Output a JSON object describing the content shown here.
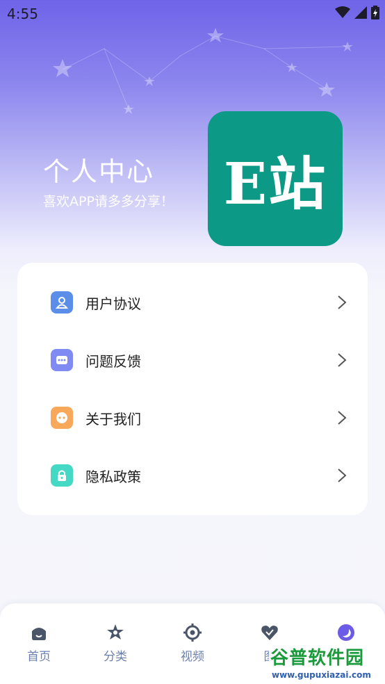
{
  "status_bar": {
    "time": "4:55"
  },
  "hero": {
    "title": "个人中心",
    "subtitle": "喜欢APP请多多分享！"
  },
  "logo": {
    "text": "E站",
    "color": "#0c9a86"
  },
  "menu": {
    "items": [
      {
        "label": "用户协议",
        "icon": "user-agreement-icon",
        "color": "#5b8ee8"
      },
      {
        "label": "问题反馈",
        "icon": "feedback-chat-icon",
        "color": "#7f8bf2"
      },
      {
        "label": "关于我们",
        "icon": "about-us-icon",
        "color": "#f7a85a"
      },
      {
        "label": "隐私政策",
        "icon": "privacy-lock-icon",
        "color": "#45d8c4"
      }
    ]
  },
  "bottom_nav": {
    "items": [
      {
        "label": "首页",
        "icon": "home-icon"
      },
      {
        "label": "分类",
        "icon": "category-star-icon"
      },
      {
        "label": "视频",
        "icon": "video-target-icon"
      },
      {
        "label": "图",
        "icon": "gallery-heart-icon"
      },
      {
        "label": "",
        "icon": "profile-moon-icon",
        "active": true
      }
    ],
    "active_color": "#6b5be6"
  },
  "watermark": {
    "title": "谷普软件园",
    "url": "www.gupuxiazai.com"
  }
}
